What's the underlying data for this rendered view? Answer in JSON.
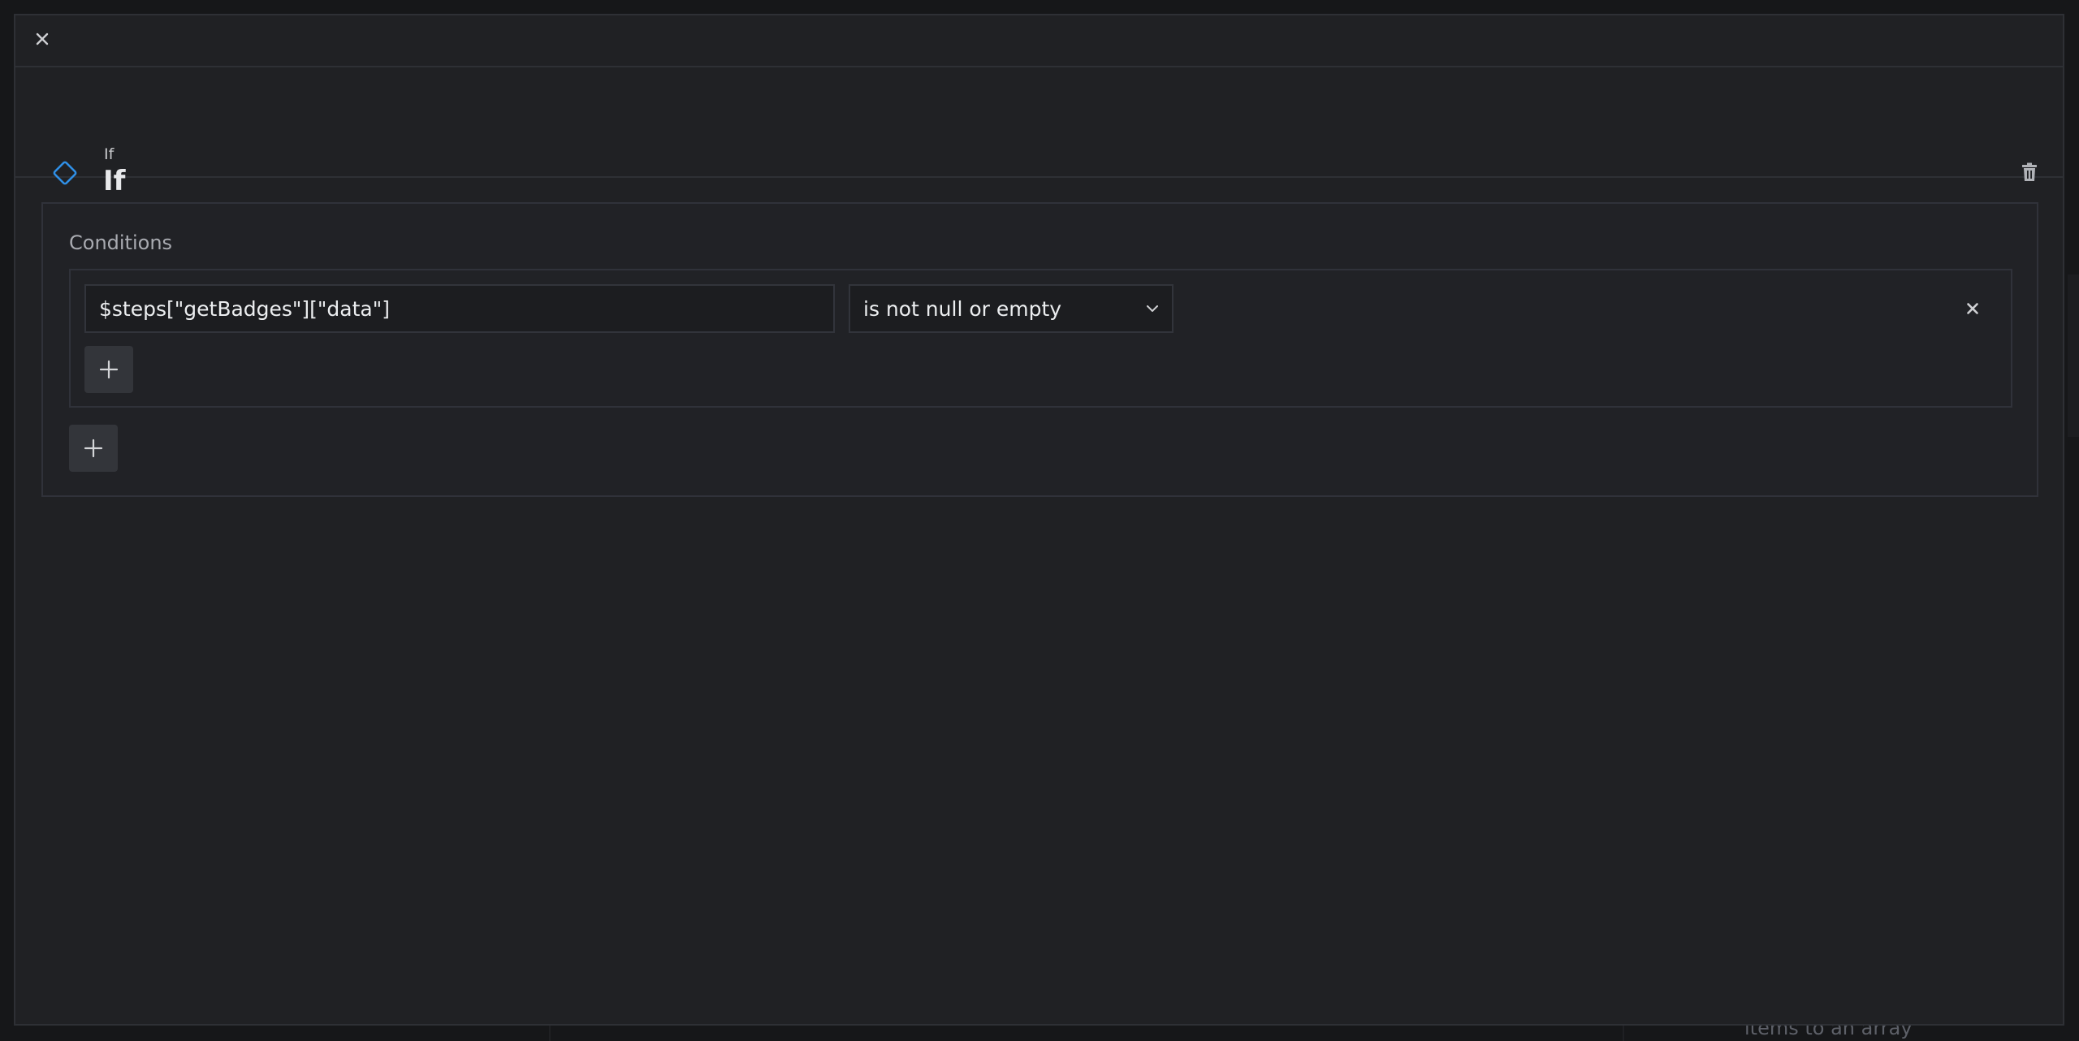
{
  "modal": {
    "node_type": "If",
    "node_title": "If"
  },
  "conditions": {
    "label": "Conditions",
    "rows": [
      {
        "expression": "$steps[\"getBadges\"][\"data\"]",
        "operator": "is not null or empty"
      }
    ]
  },
  "background": {
    "hint_text": "items to an array"
  },
  "icons": {
    "close": "close-icon",
    "node": "diamond-icon",
    "delete": "trash-icon",
    "dropdown": "chevron-down-icon",
    "remove_condition": "close-icon",
    "add": "plus-icon"
  },
  "colors": {
    "accent": "#2f8fe6",
    "modal_bg": "#202124",
    "page_bg": "#161719"
  }
}
